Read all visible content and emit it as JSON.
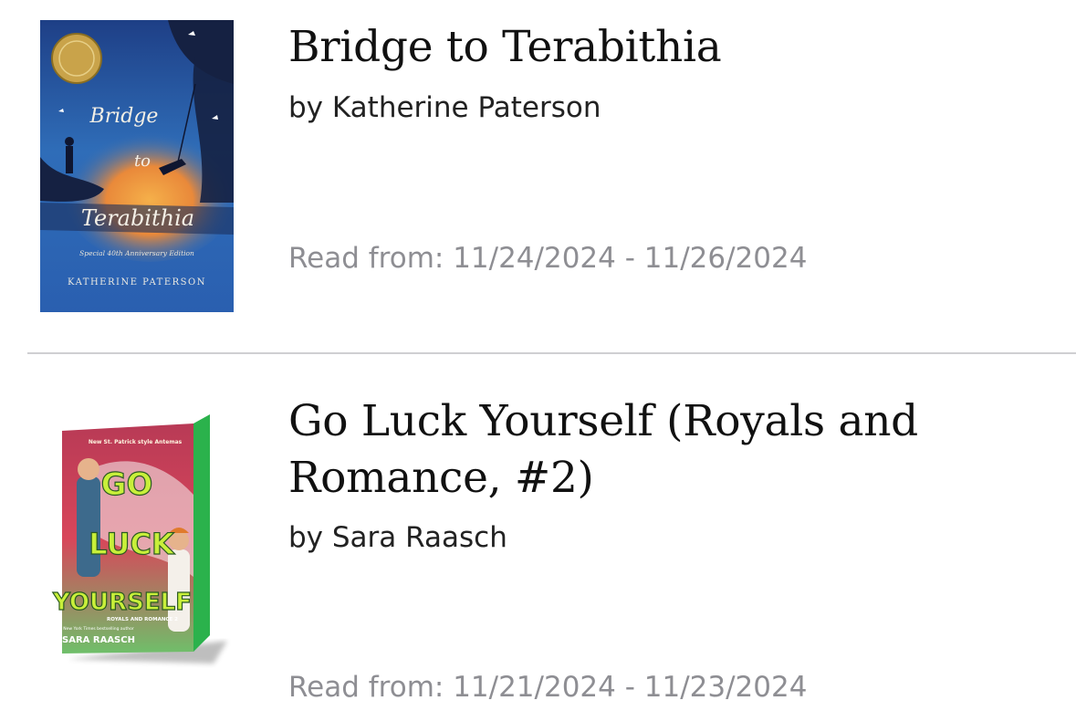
{
  "books": [
    {
      "title_lines": [
        "Bridge to Terabithia"
      ],
      "author": "by Katherine Paterson",
      "read_dates": "Read from: 11/24/2024 - 11/26/2024",
      "cover": {
        "title_words": [
          "Bridge",
          "to",
          "Terabithia"
        ],
        "edition": "Special 40th Anniversary Edition",
        "author": "KATHERINE PATERSON",
        "colors": {
          "sky": "#2f6db8",
          "glow": "#e9893a",
          "dark": "#152142"
        }
      }
    },
    {
      "title_lines": [
        "Go Luck Yourself (Royals and",
        "Romance, #2)"
      ],
      "author": "by Sara Raasch",
      "read_dates": "Read from: 11/21/2024 - 11/23/2024",
      "cover": {
        "tagline": "New St. Patrick style Antemas",
        "title_words": [
          "GO",
          "LUCK",
          "YOURSELF"
        ],
        "series": "ROYALS AND ROMANCE 2",
        "byline": "New York Times bestselling author",
        "author": "SARA RAASCH",
        "colors": {
          "background": "#d8465a",
          "title": "#c8ef3a",
          "spine": "#2bb24c"
        }
      }
    }
  ]
}
